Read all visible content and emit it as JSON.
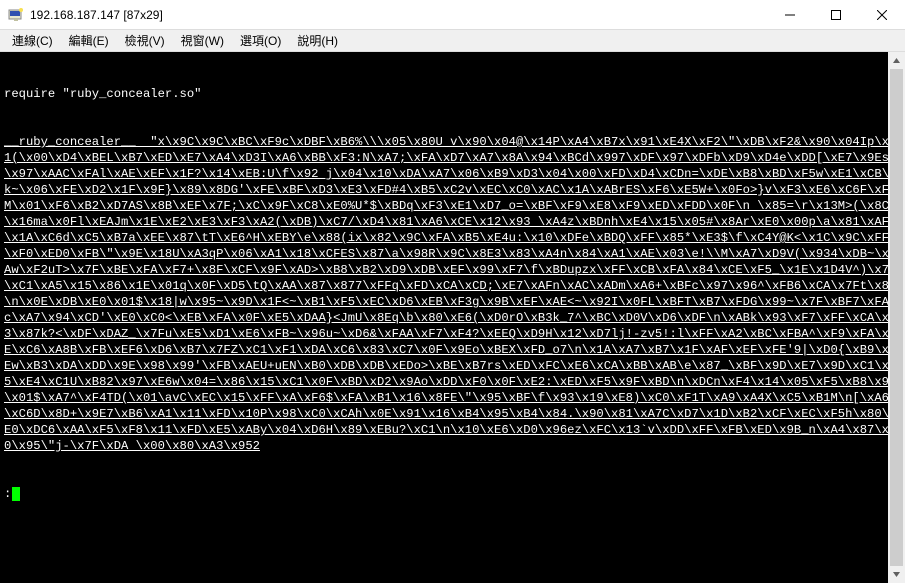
{
  "window": {
    "title": "192.168.187.147 [87x29]"
  },
  "menu": {
    "items": [
      {
        "label": "連線(C)"
      },
      {
        "label": "編輯(E)"
      },
      {
        "label": "檢視(V)"
      },
      {
        "label": "視窗(W)"
      },
      {
        "label": "選項(O)"
      },
      {
        "label": "說明(H)"
      }
    ]
  },
  "terminal": {
    "prompt": ":",
    "lines": [
      "require \"ruby_concealer.so\"",
      "__ruby_concealer__  \"x\\x9C\\x9C\\xBC\\xF9c\\xDBF\\xB6%\\\\\\x05\\x80U v\\x90\\x04@\\x14P\\xA4\\xB7x\\x91\\xE4X\\xF2\\\"\\xDB\\xF2&\\x90\\x04Ip\\x01(\\x00\\xD4\\xBEL\\xB7\\xED\\xE7\\xA4\\xD3I\\xA6\\xBB\\xF3:N\\xA7;\\xFA\\xD7\\xA7\\x8A\\x94\\xBCd\\x997\\xDF\\x97\\xDFb\\xD9\\xD4e\\xDD[\\xE7\\x9Es\\x97\\xAAC\\xFAl\\xAE\\xEF\\x1F?\\x14\\xEB:U\\f\\x92 j\\x04\\x10\\xDA\\xA7\\x06\\xB9\\xD3\\x04\\x00\\xFD\\xD4\\xCDn=\\xDE\\xB8\\xBD\\xF5w\\xE1\\xCB\\rk~\\x06\\xFE\\xD2\\x1F\\x9F}\\x89\\x8DG'\\xFE\\xBF\\xD3\\xE3\\xFD#4\\xB5\\xC2v\\xEC\\xC0\\xAC\\x1A\\xABrES\\xF6\\xE5W+\\x0Fo>}v\\xF3\\xE6\\xC6F\\xFFM\\x01\\xF6\\xB2\\xD7AS\\x8B\\xEF\\x7F;\\xC\\x9F\\xC8\\xE0%U*$\\xBDq\\xF3\\xE1\\xD7_o=\\xBF\\xF9\\xE8\\xF9\\xED\\xFDD\\x0F\\n \\x85=\\r\\x13M>(\\x8C@\\x16ma\\x0Fl\\xEAJm\\x1E\\xE2\\xE3\\xF3\\xA2(\\xDB)\\xC7/\\xD4\\x81\\xA6\\xCE\\x12\\x93 \\xA4z\\xBDnh\\xE4\\x15\\x05#\\x8Ar\\xE0\\x00p\\a\\x81\\xAF\\x1A\\xC6d\\xC5\\xB7a\\xEE\\x87\\tT\\xE6^H\\xEBY\\e\\x88(ix\\x82\\x9C\\xFA\\xB5\\xE4u:\\x10\\xDFe\\xBDQ\\xFF\\x85*\\xE3$\\f\\xC4Y@K<\\x1C\\x9C\\xFF\\xF0\\xED0\\xFB\\\"\\x9E\\x18U\\xA3qP\\x06\\xA1\\x18\\xCFES\\x87\\a\\x98R\\x9C\\x8E3\\x83\\xA4n\\x84\\xA1\\xAE\\x03\\e!\\\\M\\xA7\\xD9V(\\x934\\xDB~\\xBAw\\xF2uT>\\x7F\\xBE\\xFA\\xF7+\\x8F\\xCF\\x9F\\xAD>\\xB8\\xB2\\xD9\\xDB\\xEF\\x99\\xF7\\f\\xBDupzx\\xFF\\xCB\\xFA\\x84\\xCE\\xF5_\\x1E\\x1D4V^)\\x7F\\xC1\\xA5\\x15\\x86\\x1E\\x01q\\x0F\\xD5\\tQ\\xAA\\x87\\x877\\xFFq\\xFD\\xCA\\xCD;\\xE7\\xAFn\\xAC\\xADm\\xA6+\\xBFc\\x97\\x96^\\xFB6\\xCA\\x7Ft\\x87\\n\\x0E\\xDB\\xE0\\x01$\\x18|w\\x95~\\x9D\\x1F<~\\xB1\\xF5\\xEC\\xD6\\xEB\\xF3g\\x9B\\xEF\\xAE<~\\x92I\\x0FL\\xBFT\\xB7\\xFDG\\x99~\\x7F\\xBF7\\xFAOc\\xA7\\x94\\xCD'\\xE0\\xC0<\\xEB\\xFA\\x0F\\xE5\\xDAA}<JmU\\x8Eq\\b\\x80\\xE6(\\xD0rO\\xB3k_7^\\xBC\\xD0V\\xD6\\xDF\\n\\xABk\\x93\\xF7\\xFF\\xCA\\x93\\x87k?<\\xDF\\xDAZ_\\x7Fu\\xE5\\xD1\\xE6\\xFB~\\x96u~\\xD6&\\xFAA\\xF7\\xF4?\\xEEQ\\xD9H\\x12\\xD7lj!-zv5!:l\\xFF\\xA2\\xBC\\xFBA^\\xF9\\xFA\\xDE\\xC6\\xA8B\\xFB\\xEF6\\xD6\\xB7\\x7FZ\\xC1\\xF1\\xDA\\xC6\\x83\\xC7\\x0F\\x9Eo\\xBEX\\xFD_o7\\n\\x1A\\xA7\\xB7\\x1F\\xAF\\xEF\\xFE'9|\\xD0{\\xB9\\xFEw\\xB3\\xDA\\xDD\\x9E\\x98\\x99'\\xFB\\xAEU+uEN\\xB0\\xDB\\xDB\\xEDo>\\xBE\\xB7rs\\xED\\xFC\\xE6\\xCA\\xBB\\xAB\\e\\x87_\\xBF\\x9D\\xE7\\x9D\\xC1\\xB5\\xE4\\xC1U\\xB82\\x97\\xE6w\\x04=\\x86\\x15\\xC1\\x0F\\xBD\\xD2\\x9Ao\\xDD\\xF0\\x0F\\xE2:\\xED\\xF5\\x9F\\xBD\\n\\xDCn\\xF4\\x14\\x05\\xF5\\xB8\\x95\\x01$\\xA7^\\xF4TD(\\x01\\avC\\xEC\\x15\\xFF\\xA\\xF6$\\xFA\\xB1\\x16\\x8FE\\\"\\x95\\xBF\\f\\x93\\x19\\xE8)\\xC0\\xF1T\\xA9\\xA4X\\xC5\\xB1M\\n[\\xA6\\xC6D\\x8D+\\x9E7\\xB6\\xA1\\x11\\xFD\\x10P\\x98\\xC0\\xCAh\\x0E\\x91\\x16\\xB4\\x95\\xB4\\x84.\\x90\\x81\\xA7C\\xD7\\x1D\\xB2\\xCF\\xEC\\xF5h\\x80\\xE0\\xDC6\\xAA\\xF5\\xF8\\x11\\xFD\\xE5\\xABy\\x04\\xD6H\\x89\\xEBu?\\xC1\\n\\x10\\xE6\\xD0\\x96ez\\xFC\\x13`v\\xDD\\xFF\\xFB\\xED\\x9B_n\\xA4\\x87\\xE0\\x95\\\"j-\\x7F\\xDA \\x00\\x80\\xA3\\x952"
    ]
  }
}
